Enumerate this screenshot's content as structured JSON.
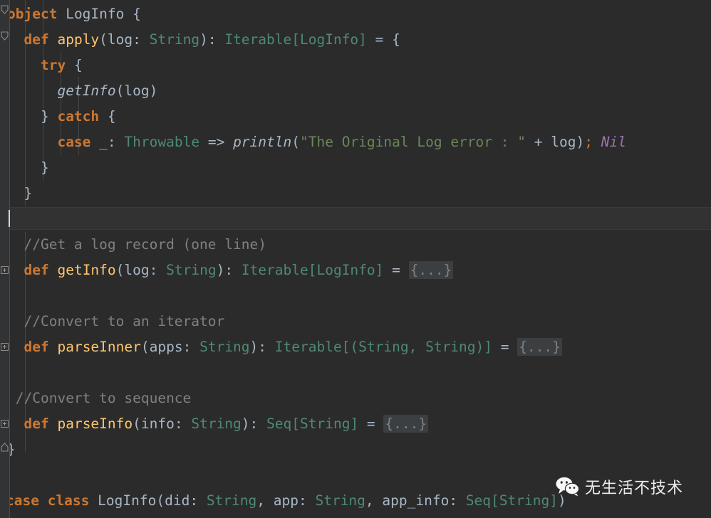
{
  "editor": {
    "language": "Scala",
    "colors": {
      "background": "#2b2b2b",
      "gutter": "#313335",
      "current_line": "#323232",
      "keyword": "#cc7832",
      "method_decl": "#ffc66d",
      "type": "#4e8975",
      "string": "#6a8759",
      "comment": "#808080",
      "identifier": "#a9b7c6",
      "nil_literal": "#9876aa",
      "fold_placeholder_bg": "#3c3f41"
    },
    "fold_placeholder": "{...}",
    "gutter_markers": [
      {
        "name": "fold-expanded-object",
        "state": "expanded",
        "line": 1
      },
      {
        "name": "fold-expanded-apply",
        "state": "expanded",
        "line": 2
      },
      {
        "name": "fold-collapsed-getinfo",
        "state": "collapsed",
        "line": 11
      },
      {
        "name": "fold-collapsed-parseinner",
        "state": "collapsed",
        "line": 14
      },
      {
        "name": "fold-collapsed-parseinfo",
        "state": "collapsed",
        "line": 17
      },
      {
        "name": "fold-expanded-object-end",
        "state": "expanded",
        "line": 18
      }
    ],
    "caret": {
      "line": 9,
      "column": 1
    },
    "current_line_number": 9
  },
  "code": {
    "lines": [
      {
        "n": 1,
        "indent": 0,
        "text": "object LogInfo {"
      },
      {
        "n": 2,
        "indent": 1,
        "text": "def apply(log: String): Iterable[LogInfo] = {"
      },
      {
        "n": 3,
        "indent": 2,
        "text": "try {"
      },
      {
        "n": 4,
        "indent": 3,
        "text": "getInfo(log)"
      },
      {
        "n": 5,
        "indent": 2,
        "text": "} catch {"
      },
      {
        "n": 6,
        "indent": 3,
        "text": "case _: Throwable => println(\"The Original Log error : \" + log); Nil"
      },
      {
        "n": 7,
        "indent": 2,
        "text": "}"
      },
      {
        "n": 8,
        "indent": 1,
        "text": "}"
      },
      {
        "n": 9,
        "indent": 0,
        "text": ""
      },
      {
        "n": 10,
        "indent": 1,
        "text": "//Get a log record (one line)"
      },
      {
        "n": 11,
        "indent": 1,
        "text": "def getInfo(log: String): Iterable[LogInfo] = {...}"
      },
      {
        "n": 12,
        "indent": 0,
        "text": ""
      },
      {
        "n": 13,
        "indent": 1,
        "text": "//Convert to an iterator"
      },
      {
        "n": 14,
        "indent": 1,
        "text": "def parseInner(apps: String): Iterable[(String, String)] = {...}"
      },
      {
        "n": 15,
        "indent": 0,
        "text": ""
      },
      {
        "n": 16,
        "indent": 1,
        "text": "//Convert to sequence"
      },
      {
        "n": 17,
        "indent": 1,
        "text": "def parseInfo(info: String): Seq[String] = {...}"
      },
      {
        "n": 18,
        "indent": 0,
        "text": "}"
      },
      {
        "n": 19,
        "indent": 0,
        "text": ""
      },
      {
        "n": 20,
        "indent": 0,
        "text": "case class LogInfo(did: String, app: String, app_info: Seq[String])"
      }
    ],
    "tokens": {
      "line1": {
        "kw": "object",
        "name": "LogInfo",
        "brace": "{"
      },
      "line2": {
        "kw": "def",
        "name": "apply",
        "param": "log",
        "ptype": "String",
        "rtype": "Iterable[LogInfo]"
      },
      "line3": {
        "kw": "try"
      },
      "line4": {
        "call": "getInfo",
        "arg": "log"
      },
      "line5": {
        "kw": "catch"
      },
      "line6": {
        "kw": "case",
        "wildcard": "_",
        "type": "Throwable",
        "arrow": "=>",
        "call": "println",
        "string": "\"The Original Log error : \"",
        "op": "+",
        "arg": "log",
        "semi": ";",
        "nil": "Nil"
      },
      "line10": {
        "comment": "//Get a log record (one line)"
      },
      "line11": {
        "kw": "def",
        "name": "getInfo",
        "param": "log",
        "ptype": "String",
        "rtype": "Iterable[LogInfo]",
        "body": "{...}"
      },
      "line13": {
        "comment": "//Convert to an iterator"
      },
      "line14": {
        "kw": "def",
        "name": "parseInner",
        "param": "apps",
        "ptype": "String",
        "rtype": "Iterable[(String, String)]",
        "body": "{...}"
      },
      "line16": {
        "comment": "//Convert to sequence"
      },
      "line17": {
        "kw": "def",
        "name": "parseInfo",
        "param": "info",
        "ptype": "String",
        "rtype": "Seq[String]",
        "body": "{...}"
      },
      "line20": {
        "kw": "case class",
        "name": "LogInfo",
        "fields": [
          "did: String",
          "app: String",
          "app_info: Seq[String]"
        ]
      }
    }
  },
  "watermark": {
    "platform_icon": "wechat-logo-icon",
    "text": "无生活不技术"
  }
}
